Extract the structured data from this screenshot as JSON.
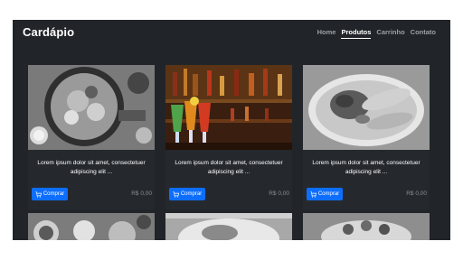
{
  "header": {
    "brand": "Cardápio",
    "nav": [
      {
        "label": "Home",
        "active": false
      },
      {
        "label": "Produtos",
        "active": true
      },
      {
        "label": "Carrinho",
        "active": false
      },
      {
        "label": "Contato",
        "active": false
      }
    ]
  },
  "products": [
    {
      "image_icon": "food-platter-image",
      "description": "Lorem ipsum dolor sit amet, consectetuer adipiscing elit ...",
      "buy_label": "Comprar",
      "price": "R$ 0,00"
    },
    {
      "image_icon": "cocktails-image",
      "description": "Lorem ipsum dolor sit amet, consectetuer adipiscing elit ...",
      "buy_label": "Comprar",
      "price": "R$ 0,00"
    },
    {
      "image_icon": "salad-plate-image",
      "description": "Lorem ipsum dolor sit amet, consectetuer adipiscing elit ...",
      "buy_label": "Comprar",
      "price": "R$ 0,00"
    }
  ],
  "colors": {
    "background": "#212529",
    "accent": "#0d6efd",
    "price": "#8b8f94"
  }
}
